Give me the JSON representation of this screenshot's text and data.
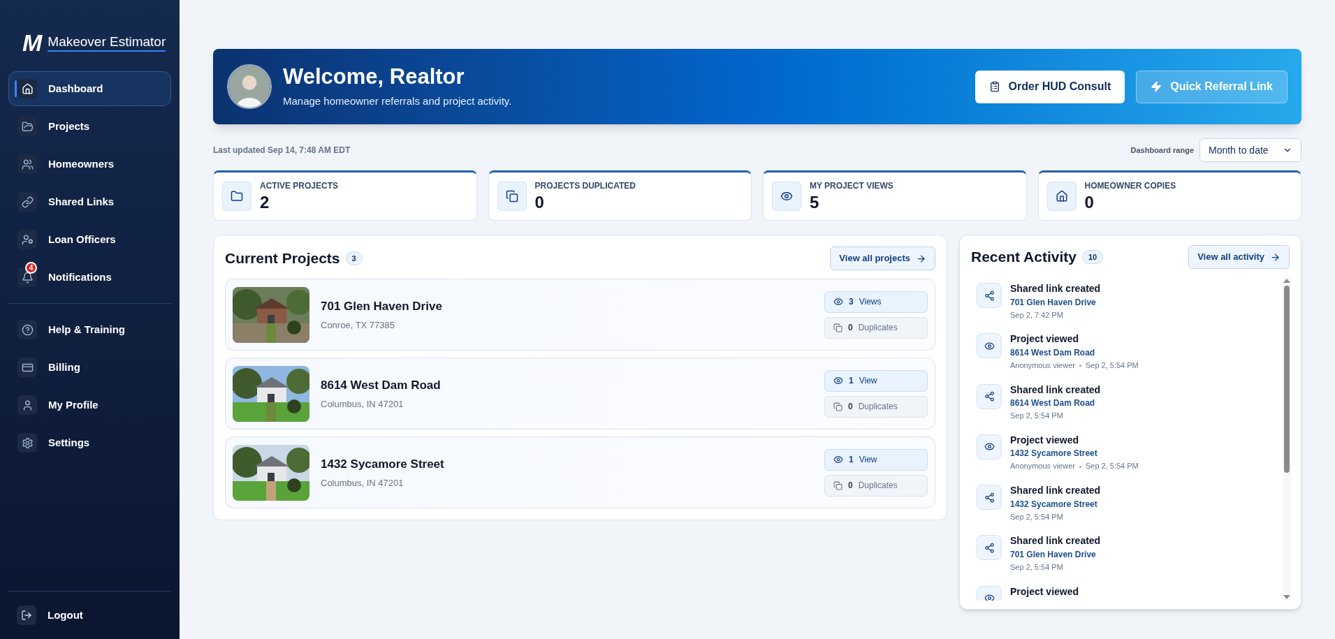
{
  "brand": {
    "mark": "M",
    "name": "Makeover Estimator"
  },
  "sidebar": {
    "items": [
      {
        "label": "Dashboard",
        "kind": "home",
        "selected": true
      },
      {
        "label": "Projects",
        "kind": "folder",
        "selected": false
      },
      {
        "label": "Homeowners",
        "kind": "users",
        "selected": false
      },
      {
        "label": "Shared Links",
        "kind": "link",
        "selected": false
      },
      {
        "label": "Loan Officers",
        "kind": "officer",
        "selected": false
      },
      {
        "label": "Notifications",
        "kind": "bell",
        "selected": false,
        "badge": "4"
      }
    ],
    "secondary_items": [
      {
        "label": "Help & Training",
        "kind": "help",
        "selected": false
      },
      {
        "label": "Billing",
        "kind": "card",
        "selected": false
      },
      {
        "label": "My Profile",
        "kind": "user",
        "selected": false
      },
      {
        "label": "Settings",
        "kind": "settings",
        "selected": false
      }
    ],
    "logout": {
      "label": "Logout"
    }
  },
  "banner": {
    "title": "Welcome, Realtor",
    "subtitle": "Manage homeowner referrals and project activity.",
    "buttons": [
      {
        "label": "Order HUD Consult",
        "kind": "primary"
      },
      {
        "label": "Quick Referral Link",
        "kind": "secondary"
      }
    ]
  },
  "last_updated": "Last updated Sep 14, 7:48 AM EDT",
  "range": {
    "label": "Dashboard range",
    "value": "Month to date"
  },
  "stats": [
    {
      "label": "ACTIVE PROJECTS",
      "value": "2",
      "kind": "folder"
    },
    {
      "label": "PROJECTS DUPLICATED",
      "value": "0",
      "kind": "copy"
    },
    {
      "label": "MY PROJECT VIEWS",
      "value": "5",
      "kind": "eye"
    },
    {
      "label": "HOMEOWNER COPIES",
      "value": "0",
      "kind": "house"
    }
  ],
  "projects": {
    "title": "Current Projects",
    "count": "3",
    "view_all": "View all projects",
    "items": [
      {
        "address": "701 Glen Haven Drive",
        "city": "Conroe, TX 77385",
        "views": "3",
        "views_label": "Views",
        "duplicates": "0",
        "duplicates_label": "Duplicates"
      },
      {
        "address": "8614 West Dam Road",
        "city": "Columbus, IN 47201",
        "views": "1",
        "views_label": "View",
        "duplicates": "0",
        "duplicates_label": "Duplicates"
      },
      {
        "address": "1432 Sycamore Street",
        "city": "Columbus, IN 47201",
        "views": "1",
        "views_label": "View",
        "duplicates": "0",
        "duplicates_label": "Duplicates"
      }
    ]
  },
  "activity": {
    "title": "Recent Activity",
    "count": "10",
    "view_all": "View all activity",
    "items": [
      {
        "kind": "share",
        "title": "Shared link created",
        "project": "701 Glen Haven Drive",
        "time": "Sep 2, 7:42 PM"
      },
      {
        "kind": "view",
        "title": "Project viewed",
        "project": "8614 West Dam Road",
        "viewer": "Anonymous viewer",
        "time": "Sep 2, 5:54 PM"
      },
      {
        "kind": "share",
        "title": "Shared link created",
        "project": "8614 West Dam Road",
        "time": "Sep 2, 5:54 PM"
      },
      {
        "kind": "view",
        "title": "Project viewed",
        "project": "1432 Sycamore Street",
        "viewer": "Anonymous viewer",
        "time": "Sep 2, 5:54 PM"
      },
      {
        "kind": "share",
        "title": "Shared link created",
        "project": "1432 Sycamore Street",
        "time": "Sep 2, 5:54 PM"
      },
      {
        "kind": "share",
        "title": "Shared link created",
        "project": "701 Glen Haven Drive",
        "time": "Sep 2, 5:54 PM"
      },
      {
        "kind": "view",
        "title": "Project viewed"
      }
    ]
  }
}
